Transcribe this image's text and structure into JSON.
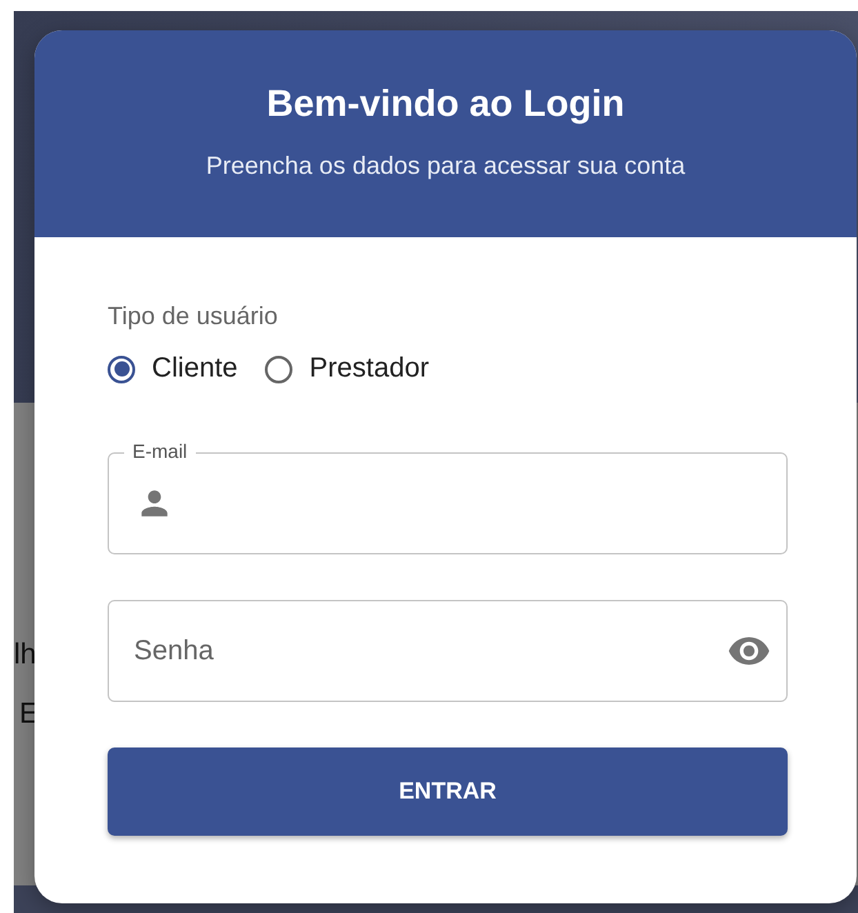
{
  "background_text": [
    "lh",
    "E"
  ],
  "dialog": {
    "title": "Bem-vindo ao Login",
    "subtitle": "Preencha os dados para acessar sua conta",
    "user_type": {
      "label": "Tipo de usuário",
      "options": [
        {
          "label": "Cliente",
          "selected": true
        },
        {
          "label": "Prestador",
          "selected": false
        }
      ]
    },
    "fields": [
      {
        "kind": "email",
        "label": "E-mail"
      },
      {
        "kind": "password",
        "placeholder": "Senha"
      }
    ],
    "submit": "ENTRAR"
  }
}
